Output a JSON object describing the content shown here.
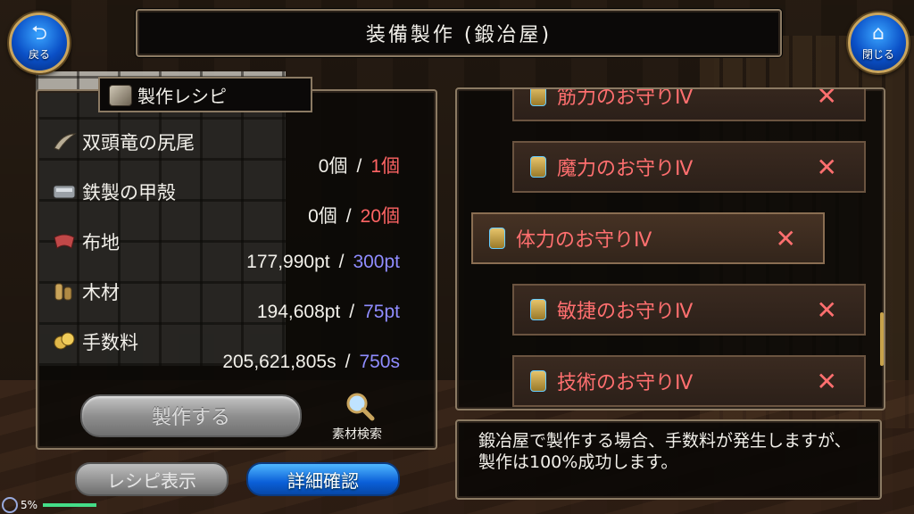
{
  "header": {
    "title": "装備製作 (鍛冶屋)",
    "back_label": "戻る",
    "close_label": "閉じる"
  },
  "recipe": {
    "title": "製作レシピ",
    "materials": [
      {
        "name": "双頭竜の尻尾",
        "have": "0個",
        "need": "1個",
        "need_color": "red"
      },
      {
        "name": "鉄製の甲殻",
        "have": "0個",
        "need": "20個",
        "need_color": "red"
      },
      {
        "name": "布地",
        "have": "177,990pt",
        "need": "300pt",
        "need_color": "blue"
      },
      {
        "name": "木材",
        "have": "194,608pt",
        "need": "75pt",
        "need_color": "blue"
      },
      {
        "name": "手数料",
        "have": "205,621,805s",
        "need": "750s",
        "need_color": "blue"
      }
    ],
    "separator": "/",
    "craft_button": "製作する",
    "search_label": "素材検索"
  },
  "tabs": {
    "recipe_display": "レシピ表示",
    "detail_check": "詳細確認"
  },
  "status": {
    "percent": "5%"
  },
  "item_list": [
    {
      "name": "筋力のお守りⅣ",
      "selected": false
    },
    {
      "name": "魔力のお守りⅣ",
      "selected": false
    },
    {
      "name": "体力のお守りⅣ",
      "selected": true
    },
    {
      "name": "敏捷のお守りⅣ",
      "selected": false
    },
    {
      "name": "技術のお守りⅣ",
      "selected": false
    }
  ],
  "description": "鍛冶屋で製作する場合、手数料が発生しますが、製作は100%成功します。",
  "colors": {
    "need_red": "#ff6464",
    "need_blue": "#8f8cff",
    "frame_gold": "#8b7a63",
    "button_blue": "#0b5fd8"
  }
}
